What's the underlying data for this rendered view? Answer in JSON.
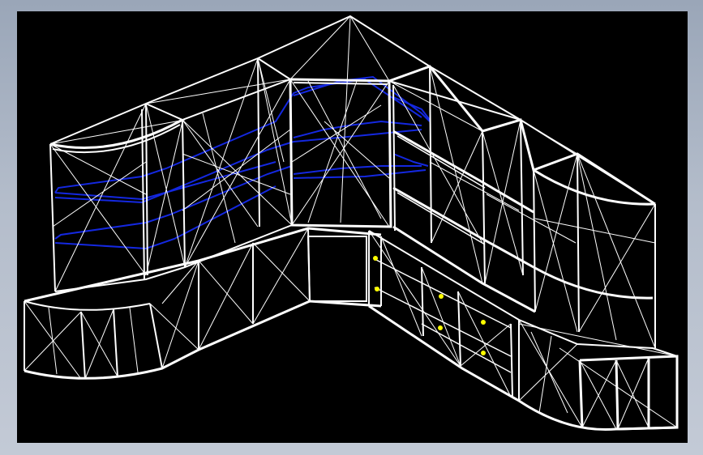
{
  "window": {
    "frame": "cad-viewport-window"
  },
  "viewport": {
    "background_color": "#000000",
    "view_mode": "wireframe-3d-isometric",
    "model_name": "corner-cabinet-unit",
    "colors": {
      "wire": "#ffffff",
      "shelf": "#1428e0",
      "handle": "#ffff00"
    }
  }
}
